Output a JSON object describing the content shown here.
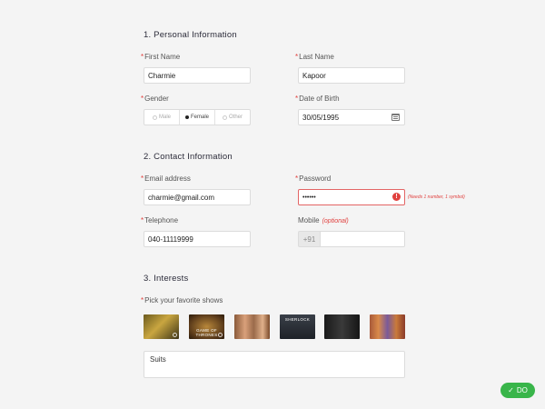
{
  "sections": {
    "personal": "1. Personal Information",
    "contact": "2. Contact Information",
    "interests": "3. Interests"
  },
  "personal": {
    "first_name_label": "First Name",
    "first_name_value": "Charmie",
    "last_name_label": "Last Name",
    "last_name_value": "Kapoor",
    "gender_label": "Gender",
    "gender_options": [
      "Male",
      "Female",
      "Other"
    ],
    "gender_selected": "Female",
    "dob_label": "Date of Birth",
    "dob_value": "30/05/1995"
  },
  "contact": {
    "email_label": "Email address",
    "email_value": "charmie@gmail.com",
    "password_label": "Password",
    "password_value": "••••••",
    "password_error": "(Needs 1 number, 1 symbol)",
    "telephone_label": "Telephone",
    "telephone_value": "040-11119999",
    "mobile_label": "Mobile",
    "mobile_optional": "(optional)",
    "mobile_prefix": "+91",
    "mobile_value": ""
  },
  "interests": {
    "shows_label": "Pick your favorite shows",
    "shows": [
      {
        "icon": "breaking-bad-thumbnail",
        "label": ""
      },
      {
        "icon": "game-of-thrones-thumbnail",
        "label": "GAME OF THRONES"
      },
      {
        "icon": "friends-thumbnail",
        "label": ""
      },
      {
        "icon": "sherlock-thumbnail",
        "label": "SHERLOCK"
      },
      {
        "icon": "suits-thumbnail",
        "label": ""
      },
      {
        "icon": "big-bang-theory-thumbnail",
        "label": ""
      }
    ],
    "notes_value": "Suits"
  },
  "actions": {
    "do_label": "DO"
  },
  "colors": {
    "accent_error": "#e0403e",
    "success": "#39b54a"
  }
}
